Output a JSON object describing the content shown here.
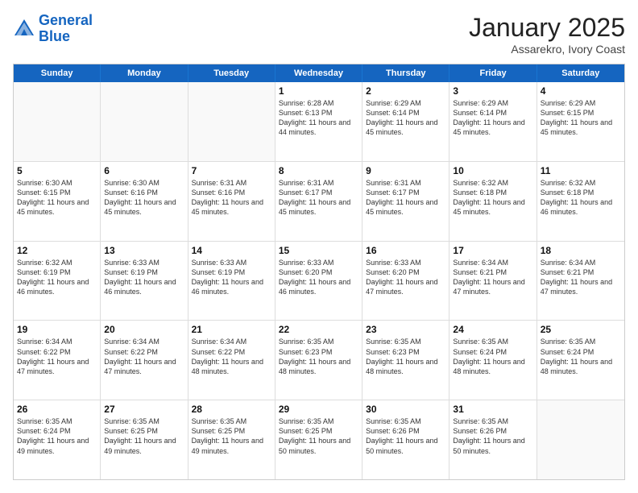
{
  "logo": {
    "line1": "General",
    "line2": "Blue"
  },
  "title": "January 2025",
  "location": "Assarekro, Ivory Coast",
  "days_of_week": [
    "Sunday",
    "Monday",
    "Tuesday",
    "Wednesday",
    "Thursday",
    "Friday",
    "Saturday"
  ],
  "weeks": [
    [
      {
        "day": null,
        "info": null
      },
      {
        "day": null,
        "info": null
      },
      {
        "day": null,
        "info": null
      },
      {
        "day": "1",
        "sunrise": "6:28 AM",
        "sunset": "6:13 PM",
        "daylight": "11 hours and 44 minutes."
      },
      {
        "day": "2",
        "sunrise": "6:29 AM",
        "sunset": "6:14 PM",
        "daylight": "11 hours and 45 minutes."
      },
      {
        "day": "3",
        "sunrise": "6:29 AM",
        "sunset": "6:14 PM",
        "daylight": "11 hours and 45 minutes."
      },
      {
        "day": "4",
        "sunrise": "6:29 AM",
        "sunset": "6:15 PM",
        "daylight": "11 hours and 45 minutes."
      }
    ],
    [
      {
        "day": "5",
        "sunrise": "6:30 AM",
        "sunset": "6:15 PM",
        "daylight": "11 hours and 45 minutes."
      },
      {
        "day": "6",
        "sunrise": "6:30 AM",
        "sunset": "6:16 PM",
        "daylight": "11 hours and 45 minutes."
      },
      {
        "day": "7",
        "sunrise": "6:31 AM",
        "sunset": "6:16 PM",
        "daylight": "11 hours and 45 minutes."
      },
      {
        "day": "8",
        "sunrise": "6:31 AM",
        "sunset": "6:17 PM",
        "daylight": "11 hours and 45 minutes."
      },
      {
        "day": "9",
        "sunrise": "6:31 AM",
        "sunset": "6:17 PM",
        "daylight": "11 hours and 45 minutes."
      },
      {
        "day": "10",
        "sunrise": "6:32 AM",
        "sunset": "6:18 PM",
        "daylight": "11 hours and 45 minutes."
      },
      {
        "day": "11",
        "sunrise": "6:32 AM",
        "sunset": "6:18 PM",
        "daylight": "11 hours and 46 minutes."
      }
    ],
    [
      {
        "day": "12",
        "sunrise": "6:32 AM",
        "sunset": "6:19 PM",
        "daylight": "11 hours and 46 minutes."
      },
      {
        "day": "13",
        "sunrise": "6:33 AM",
        "sunset": "6:19 PM",
        "daylight": "11 hours and 46 minutes."
      },
      {
        "day": "14",
        "sunrise": "6:33 AM",
        "sunset": "6:19 PM",
        "daylight": "11 hours and 46 minutes."
      },
      {
        "day": "15",
        "sunrise": "6:33 AM",
        "sunset": "6:20 PM",
        "daylight": "11 hours and 46 minutes."
      },
      {
        "day": "16",
        "sunrise": "6:33 AM",
        "sunset": "6:20 PM",
        "daylight": "11 hours and 47 minutes."
      },
      {
        "day": "17",
        "sunrise": "6:34 AM",
        "sunset": "6:21 PM",
        "daylight": "11 hours and 47 minutes."
      },
      {
        "day": "18",
        "sunrise": "6:34 AM",
        "sunset": "6:21 PM",
        "daylight": "11 hours and 47 minutes."
      }
    ],
    [
      {
        "day": "19",
        "sunrise": "6:34 AM",
        "sunset": "6:22 PM",
        "daylight": "11 hours and 47 minutes."
      },
      {
        "day": "20",
        "sunrise": "6:34 AM",
        "sunset": "6:22 PM",
        "daylight": "11 hours and 47 minutes."
      },
      {
        "day": "21",
        "sunrise": "6:34 AM",
        "sunset": "6:22 PM",
        "daylight": "11 hours and 48 minutes."
      },
      {
        "day": "22",
        "sunrise": "6:35 AM",
        "sunset": "6:23 PM",
        "daylight": "11 hours and 48 minutes."
      },
      {
        "day": "23",
        "sunrise": "6:35 AM",
        "sunset": "6:23 PM",
        "daylight": "11 hours and 48 minutes."
      },
      {
        "day": "24",
        "sunrise": "6:35 AM",
        "sunset": "6:24 PM",
        "daylight": "11 hours and 48 minutes."
      },
      {
        "day": "25",
        "sunrise": "6:35 AM",
        "sunset": "6:24 PM",
        "daylight": "11 hours and 48 minutes."
      }
    ],
    [
      {
        "day": "26",
        "sunrise": "6:35 AM",
        "sunset": "6:24 PM",
        "daylight": "11 hours and 49 minutes."
      },
      {
        "day": "27",
        "sunrise": "6:35 AM",
        "sunset": "6:25 PM",
        "daylight": "11 hours and 49 minutes."
      },
      {
        "day": "28",
        "sunrise": "6:35 AM",
        "sunset": "6:25 PM",
        "daylight": "11 hours and 49 minutes."
      },
      {
        "day": "29",
        "sunrise": "6:35 AM",
        "sunset": "6:25 PM",
        "daylight": "11 hours and 50 minutes."
      },
      {
        "day": "30",
        "sunrise": "6:35 AM",
        "sunset": "6:26 PM",
        "daylight": "11 hours and 50 minutes."
      },
      {
        "day": "31",
        "sunrise": "6:35 AM",
        "sunset": "6:26 PM",
        "daylight": "11 hours and 50 minutes."
      },
      {
        "day": null,
        "info": null
      }
    ]
  ]
}
